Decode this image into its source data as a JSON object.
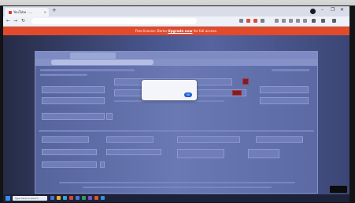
{
  "outer_browser": {
    "tab_title": "YouTube - ...",
    "new_tab_glyph": "+",
    "address_text": "",
    "window_controls": [
      "–",
      "❐",
      "✕"
    ],
    "nav": {
      "back": "←",
      "forward": "→",
      "reload": "↻"
    }
  },
  "banner": {
    "text": "Free license: Demo ",
    "link": "Upgrade now",
    "suffix": " for full access."
  },
  "inner_browser": {
    "tab_title": "",
    "address_text": ""
  },
  "popup": {
    "line1": "",
    "line2": "",
    "ok_label": "OK"
  },
  "taskbar": {
    "search_placeholder": "Type here to search",
    "tray_text": "",
    "side_button": ""
  },
  "icons": {
    "start": "windows-start-icon",
    "profile": "profile-avatar-icon",
    "extension": "extension-icon"
  },
  "colors": {
    "banner": "#e24a2c",
    "screen_bg": "#3a4570",
    "ok_button": "#1a5fd6",
    "delete_button": "#7a1f2e"
  }
}
